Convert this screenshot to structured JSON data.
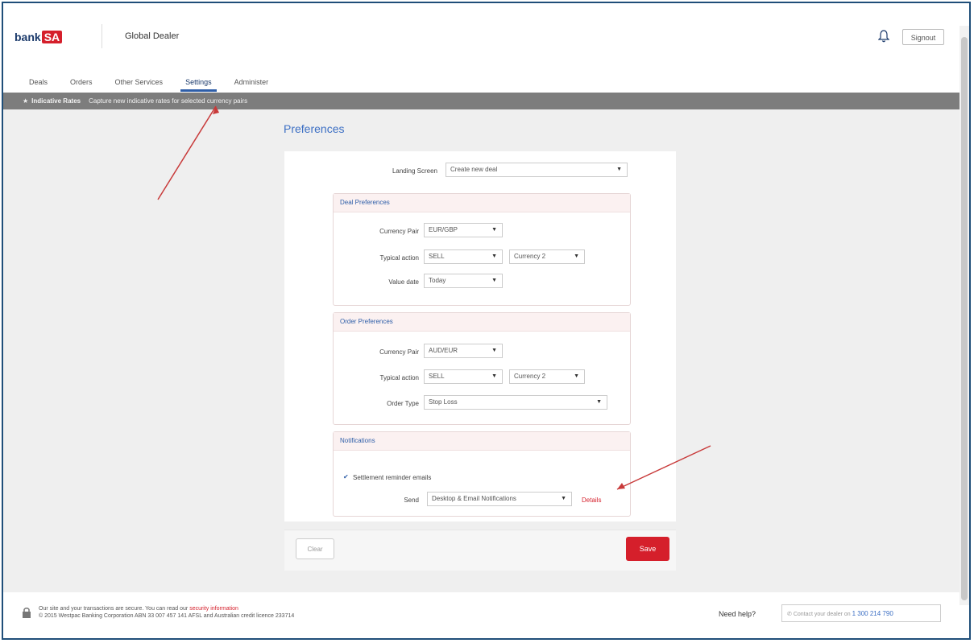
{
  "header": {
    "logo_text": "bank",
    "logo_mark": "SA",
    "app_title": "Global Dealer",
    "bell_icon": "bell-icon",
    "signout_label": "Signout"
  },
  "nav": {
    "tabs": [
      {
        "label": "Deals"
      },
      {
        "label": "Orders"
      },
      {
        "label": "Other Services"
      },
      {
        "label": "Settings",
        "active": true
      },
      {
        "label": "Administer"
      }
    ]
  },
  "notice": {
    "label": "Indicative Rates",
    "text": "Capture new indicative rates for selected currency pairs"
  },
  "page": {
    "title": "Preferences",
    "landing_label": "Landing Screen",
    "landing_value": "Create new deal",
    "deal_prefs": {
      "title": "Deal Preferences",
      "currency_pair_label": "Currency Pair",
      "currency_pair_value": "EUR/GBP",
      "typical_action_label": "Typical action",
      "typical_action_value": "SELL",
      "currency_value": "Currency 2",
      "value_date_label": "Value date",
      "value_date_value": "Today"
    },
    "order_prefs": {
      "title": "Order Preferences",
      "currency_pair_label": "Currency Pair",
      "currency_pair_value": "AUD/EUR",
      "typical_action_label": "Typical action",
      "typical_action_value": "SELL",
      "currency_value": "Currency 2",
      "order_type_label": "Order Type",
      "order_type_value": "Stop Loss"
    },
    "notifications": {
      "title": "Notifications",
      "settlement_label": "Settlement reminder emails",
      "send_label": "Send",
      "send_value": "Desktop & Email Notifications",
      "details_link": "Details"
    },
    "buttons": {
      "clear": "Clear",
      "save": "Save"
    }
  },
  "footer": {
    "line1_pre": "Our site and your transactions are secure. You can read our",
    "line1_link": "security information",
    "line2": "© 2015 Westpac Banking Corporation ABN 33 007 457 141 AFSL and Australian credit licence 233714",
    "help_label": "Need help?",
    "help_text": "Contact your dealer on",
    "help_phone": "1 300 214 790"
  },
  "colors": {
    "brand_red": "#d51f2b",
    "brand_blue": "#1b3a6b",
    "link_blue": "#3c6fc4",
    "annotation_red": "#c83a3a"
  }
}
